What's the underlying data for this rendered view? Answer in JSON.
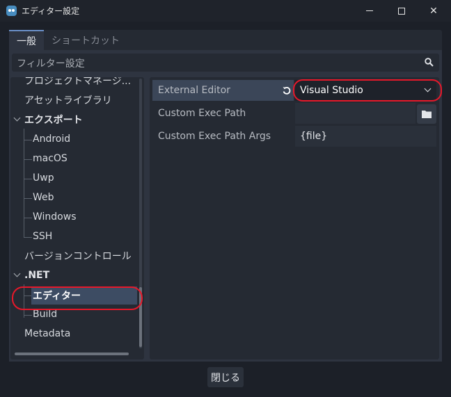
{
  "window": {
    "title": "エディター設定",
    "icon": "godot-icon",
    "controls": [
      "minimize-icon",
      "maximize-icon",
      "close-icon"
    ]
  },
  "tabs": [
    {
      "label": "一般",
      "active": true
    },
    {
      "label": "ショートカット",
      "active": false
    }
  ],
  "filter": {
    "placeholder": "フィルター設定",
    "icon": "search-icon"
  },
  "tree": {
    "items": [
      {
        "label": "プロジェクトマネージ...",
        "level": 1,
        "bold": false
      },
      {
        "label": "アセットライブラリ",
        "level": 1,
        "bold": false
      },
      {
        "label": "エクスポート",
        "level": 1,
        "bold": true,
        "expanded": true
      },
      {
        "label": "Android",
        "level": 2,
        "bold": false
      },
      {
        "label": "macOS",
        "level": 2,
        "bold": false
      },
      {
        "label": "Uwp",
        "level": 2,
        "bold": false
      },
      {
        "label": "Web",
        "level": 2,
        "bold": false
      },
      {
        "label": "Windows",
        "level": 2,
        "bold": false
      },
      {
        "label": "SSH",
        "level": 2,
        "bold": false
      },
      {
        "label": "バージョンコントロール",
        "level": 1,
        "bold": false
      },
      {
        "label": ".NET",
        "level": 1,
        "bold": true,
        "expanded": true
      },
      {
        "label": "エディター",
        "level": 2,
        "bold": true,
        "selected": true
      },
      {
        "label": "Build",
        "level": 2,
        "bold": false
      },
      {
        "label": "Metadata",
        "level": 1,
        "bold": false
      }
    ]
  },
  "inspector": {
    "properties": [
      {
        "label": "External Editor",
        "value": "Visual Studio",
        "type": "dropdown",
        "modified": true
      },
      {
        "label": "Custom Exec Path",
        "value": "",
        "type": "path"
      },
      {
        "label": "Custom Exec Path Args",
        "value": "{file}",
        "type": "text"
      }
    ]
  },
  "footer": {
    "close_label": "閉じる"
  },
  "colors": {
    "annotation": "#e8182a",
    "selection": "#3d4c63",
    "accent": "#6a8fc7"
  }
}
